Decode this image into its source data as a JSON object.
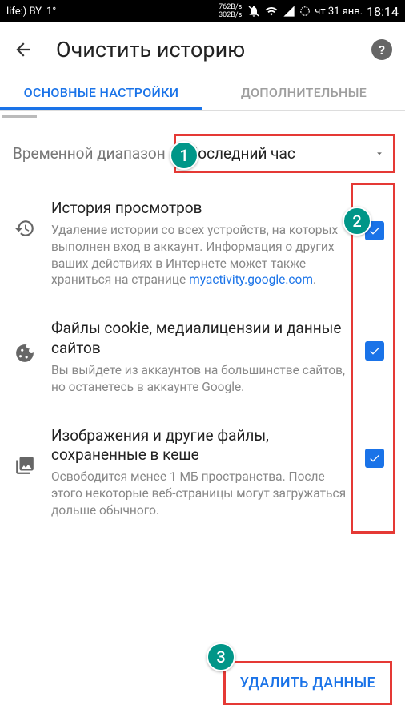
{
  "status_bar": {
    "carrier": "life:) BY",
    "temp": "1°",
    "speed_down": "762B/s",
    "speed_up": "302B/s",
    "date": "чт 31 янв.",
    "time": "18:14"
  },
  "header": {
    "title": "Очистить историю"
  },
  "tabs": {
    "basic": "ОСНОВНЫЕ НАСТРОЙКИ",
    "advanced": "ДОПОЛНИТЕЛЬНЫЕ"
  },
  "time_range": {
    "label": "Временной диапазон",
    "value": "Последний час"
  },
  "options": [
    {
      "title": "История просмотров",
      "desc_pre": "Удаление истории со всех устройств, на которых выполнен вход в аккаунт. Информация о других ваших действиях в Интернете может также храниться на странице ",
      "link": "myactivity.google.com",
      "desc_post": ".",
      "checked": true
    },
    {
      "title": "Файлы cookie, медиалицензии и данные сайтов",
      "desc_pre": "Вы выйдете из аккаунтов на большинстве сайтов, но останетесь в аккаунте Google.",
      "link": "",
      "desc_post": "",
      "checked": true
    },
    {
      "title": "Изображения и другие файлы, сохраненные в кеше",
      "desc_pre": "Освободится менее 1 МБ пространства. После этого некоторые веб-страницы могут загружаться дольше обычного.",
      "link": "",
      "desc_post": "",
      "checked": true
    }
  ],
  "footer": {
    "delete": "УДАЛИТЬ ДАННЫЕ"
  },
  "steps": {
    "s1": "1",
    "s2": "2",
    "s3": "3"
  }
}
